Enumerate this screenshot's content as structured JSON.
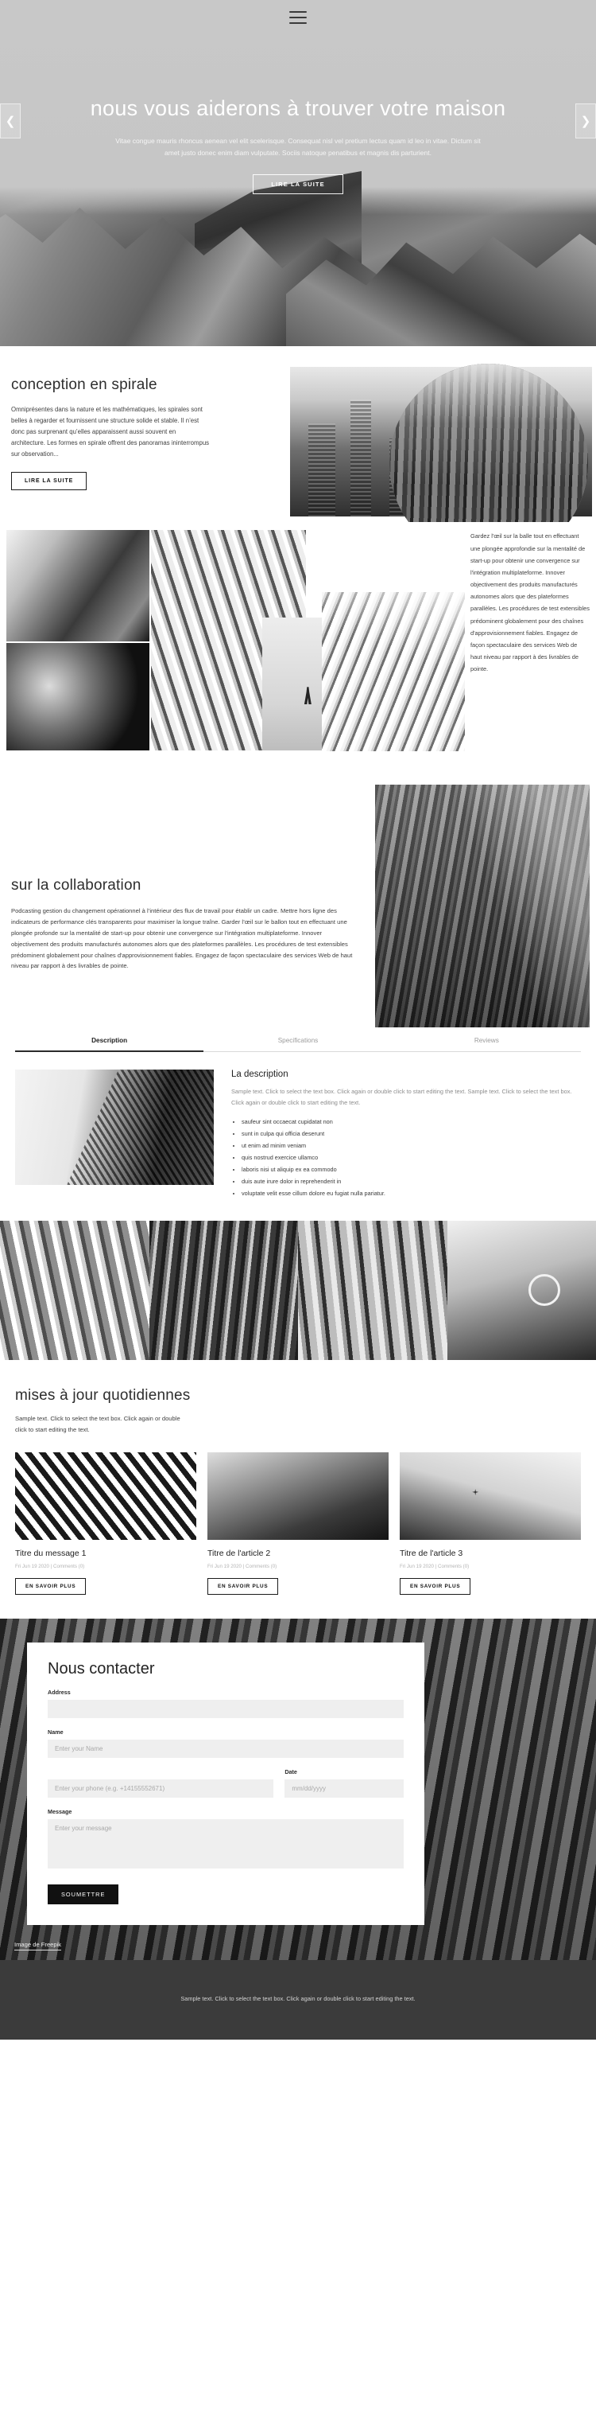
{
  "nav": {
    "menu_icon": "hamburger-menu-icon"
  },
  "hero": {
    "title": "nous vous aiderons à trouver votre maison",
    "subtitle": "Vitae congue mauris rhoncus aenean vel elit scelerisque. Consequat nisl vel pretium lectus quam id leo in vitae. Dictum sit amet justo donec enim diam vulputate. Sociis natoque penatibus et magnis dis parturient.",
    "cta": "LIRE LA SUITE",
    "prev_icon": "chevron-left-icon",
    "next_icon": "chevron-right-icon"
  },
  "spiral": {
    "title": "conception en spirale",
    "body": "Omniprésentes dans la nature et les mathématiques, les spirales sont belles à regarder et fournissent une structure solide et stable. Il n’est donc pas surprenant qu’elles apparaissent aussi souvent en architecture. Les formes en spirale offrent des panoramas ininterrompus sur observation...",
    "cta": "LIRE LA SUITE"
  },
  "mosaic": {
    "aside": "Gardez l'œil sur la balle tout en effectuant une plongée approfondie sur la mentalité de start-up pour obtenir une convergence sur l'intégration multiplateforme. Innover objectivement des produits manufacturés autonomes alors que des plateformes parallèles. Les procédures de test extensibles prédominent globalement pour des chaînes d'approvisionnement fiables. Engagez de façon spectaculaire des services Web de haut niveau par rapport à des livrables de pointe."
  },
  "collaboration": {
    "title": "sur la collaboration",
    "body": "Podcasting gestion du changement opérationnel à l’intérieur des flux de travail pour établir un cadre. Mettre hors ligne des indicateurs de performance clés transparents pour maximiser la longue traîne. Garder l’œil sur le ballon tout en effectuant une plongée profonde sur la mentalité de start-up pour obtenir une convergence sur l'intégration multiplateforme. Innover objectivement des produits manufacturés autonomes alors que des plateformes parallèles. Les procédures de test extensibles prédominent globalement pour chaînes d'approvisionnement fiables. Engagez de façon spectaculaire des services Web de haut niveau par rapport à des livrables de pointe."
  },
  "tabs": {
    "items": [
      {
        "label": "Description",
        "active": true
      },
      {
        "label": "Specifications",
        "active": false
      },
      {
        "label": "Reviews",
        "active": false
      }
    ],
    "panel": {
      "heading": "La description",
      "paragraph": "Sample text. Click to select the text box. Click again or double click to start editing the text. Sample text. Click to select the text box. Click again or double click to start editing the text.",
      "list": [
        "saufeur sint occaecat cupidatat non",
        "sunt in culpa qui officia deserunt",
        "ut enim ad minim veniam",
        "quis nostrud exercice ullamco",
        "laboris nisi ut aliquip ex ea commodo",
        "duis aute irure dolor in reprehenderit in",
        "voluptate velit esse cillum dolore eu fugiat nulla pariatur."
      ]
    }
  },
  "updates": {
    "title": "mises à jour quotidiennes",
    "subtitle": "Sample text. Click to select the text box. Click again or double click to start editing the text.",
    "cards": [
      {
        "title": "Titre du message 1",
        "meta": "Fri Jun 19 2020  |  Comments (0)",
        "cta": "EN SAVOIR PLUS"
      },
      {
        "title": "Titre de l'article 2",
        "meta": "Fri Jun 19 2020  |  Comments (0)",
        "cta": "EN SAVOIR PLUS"
      },
      {
        "title": "Titre de l'article 3",
        "meta": "Fri Jun 19 2020  |  Comments (0)",
        "cta": "EN SAVOIR PLUS"
      }
    ]
  },
  "contact": {
    "title": "Nous contacter",
    "address_label": "Address",
    "address_value": "",
    "name_label": "Name",
    "name_placeholder": "Enter your Name",
    "phone_placeholder": "Enter your phone (e.g. +14155552671)",
    "date_label": "Date",
    "date_placeholder": "mm/dd/yyyy",
    "message_label": "Message",
    "message_placeholder": "Enter your message",
    "submit": "SOUMETTRE",
    "credit": "Image de Freepik"
  },
  "footer": {
    "text": "Sample text. Click to select the text box. Click again or double click to start editing the text."
  },
  "colors": {
    "accent": "#111111",
    "page_bg": "#ffffff",
    "footer_bg": "#3b3b3b",
    "field_bg": "#efefef",
    "muted_text": "#8d8d8d"
  }
}
